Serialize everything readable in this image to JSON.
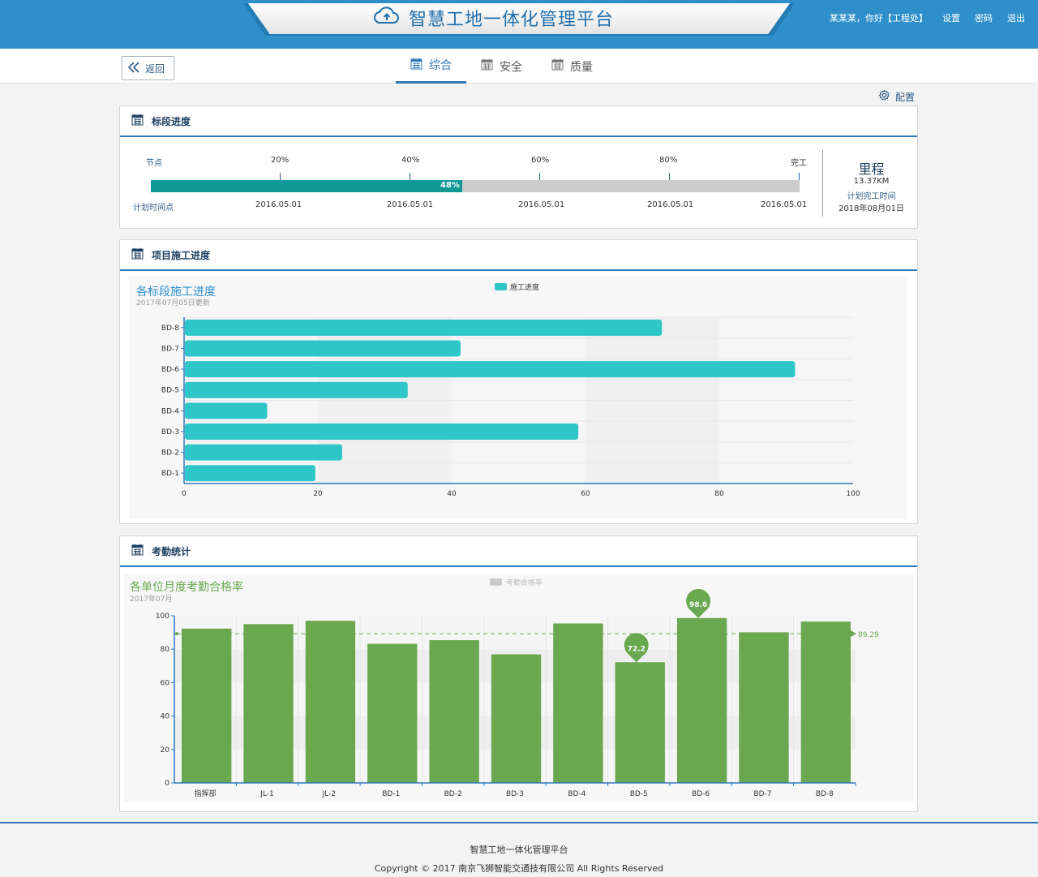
{
  "header": {
    "app_title": "智慧工地一体化管理平台",
    "greeting": "某某某，你好【工程处】",
    "settings": "设置",
    "password": "密码",
    "logout": "退出",
    "brand_color": "#2f8fcb"
  },
  "nav": {
    "back": "返回",
    "tabs": [
      {
        "label": "综合",
        "active": true
      },
      {
        "label": "安全",
        "active": false
      },
      {
        "label": "质量",
        "active": false
      }
    ],
    "config": "配置"
  },
  "section_progress": {
    "title": "标段进度",
    "node_label": "节点",
    "plan_label": "计划时间点",
    "milestones": [
      "20%",
      "40%",
      "60%",
      "80%",
      "完工"
    ],
    "dates": [
      "2016.05.01",
      "2016.05.01",
      "2016.05.01",
      "2016.05.01",
      "2016.05.01"
    ],
    "progress_percent": 48,
    "progress_text": "48%",
    "fill_color": "#0f9a96",
    "mileage_title": "里程",
    "mileage_value": "13.37KM",
    "plan_finish_label": "计划完工时间",
    "plan_finish_date": "2018年08月01日"
  },
  "section_construction": {
    "title": "项目施工进度",
    "chart_title": "各标段施工进度",
    "chart_subtitle": "2017年07月05日更新",
    "legend": "施工进度"
  },
  "section_attendance": {
    "title": "考勤统计",
    "chart_title": "各单位月度考勤合格率",
    "chart_subtitle": "2017年07月",
    "legend": "考勤合格率",
    "average_label": "89.29",
    "max_label": "98.6",
    "min_label": "72.2"
  },
  "footer": {
    "line1": "智慧工地一体化管理平台",
    "line2": "Copyright © 2017 南京飞狮智能交通技有限公司 All Rights Reserved"
  },
  "chart_data": [
    {
      "type": "bar",
      "orientation": "horizontal",
      "title": "各标段施工进度",
      "subtitle": "2017年07月05日更新",
      "categories": [
        "BD-1",
        "BD-2",
        "BD-3",
        "BD-4",
        "BD-5",
        "BD-6",
        "BD-7",
        "BD-8"
      ],
      "series": [
        {
          "name": "施工进度",
          "values": [
            19.5,
            23.5,
            58.8,
            12.3,
            33.3,
            91.2,
            41.2,
            71.3
          ]
        }
      ],
      "xlim": [
        0,
        100
      ],
      "xticks": [
        0,
        20,
        40,
        60,
        80,
        100
      ],
      "color": "#2ec6c9",
      "legend_position": "top-center"
    },
    {
      "type": "bar",
      "title": "各单位月度考勤合格率",
      "subtitle": "2017年07月",
      "categories": [
        "指挥部",
        "JL-1",
        "JL-2",
        "BD-1",
        "BD-2",
        "BD-3",
        "BD-4",
        "BD-5",
        "BD-6",
        "BD-7",
        "BD-8"
      ],
      "series": [
        {
          "name": "考勤合格率",
          "values": [
            92.3,
            95,
            97,
            83.2,
            85.4,
            76.9,
            95.4,
            72.2,
            98.6,
            90.1,
            96.5
          ]
        }
      ],
      "ylim": [
        0,
        100
      ],
      "yticks": [
        0,
        20,
        40,
        60,
        80,
        100
      ],
      "average_line": 89.29,
      "max_marker": 98.6,
      "min_marker": 72.2,
      "color": "#6aa84f",
      "legend_position": "top-center"
    }
  ]
}
